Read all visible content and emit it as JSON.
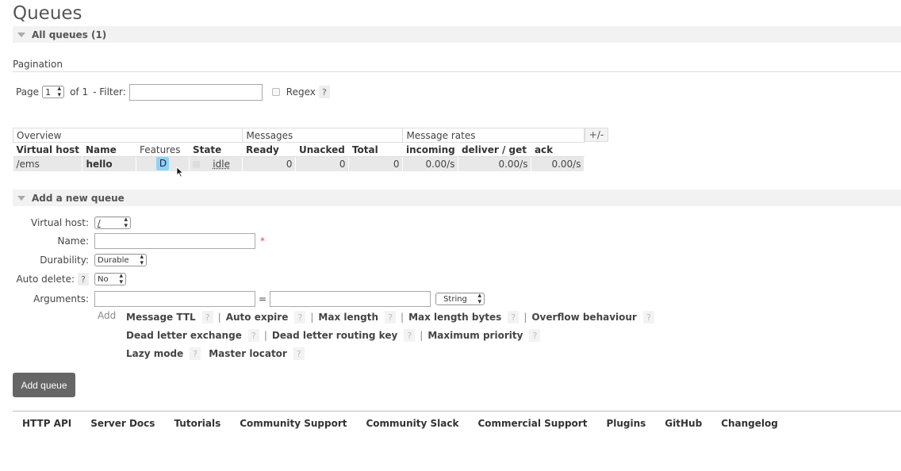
{
  "page_title": "Queues",
  "all_queues_label": "All queues (1)",
  "pagination": {
    "label": "Pagination",
    "page_prefix": "Page",
    "page_value": "1",
    "of_text": "of 1",
    "filter_label": "- Filter:",
    "filter_value": "",
    "regex_label": "Regex",
    "help": "?"
  },
  "table": {
    "groups": [
      "Overview",
      "Messages",
      "Message rates"
    ],
    "columns": [
      "Virtual host",
      "Name",
      "Features",
      "State",
      "Ready",
      "Unacked",
      "Total",
      "incoming",
      "deliver / get",
      "ack"
    ],
    "toggle": "+/-",
    "rows": [
      {
        "vhost": "/ems",
        "name": "hello",
        "feature": "D",
        "state": "idle",
        "ready": "0",
        "unacked": "0",
        "total": "0",
        "incoming": "0.00/s",
        "deliver_get": "0.00/s",
        "ack": "0.00/s"
      }
    ]
  },
  "add_queue_section": {
    "title": "Add a new queue",
    "virtual_host_label": "Virtual host:",
    "virtual_host_value": "/",
    "name_label": "Name:",
    "name_value": "",
    "required_mark": "*",
    "durability_label": "Durability:",
    "durability_value": "Durable",
    "auto_delete_label": "Auto delete:",
    "auto_delete_value": "No",
    "arguments_label": "Arguments:",
    "arg_equals": "=",
    "arg_type_value": "String",
    "add_text": "Add",
    "arg_links_row1": [
      "Message TTL",
      "Auto expire",
      "Max length",
      "Max length bytes",
      "Overflow behaviour"
    ],
    "arg_links_row2": [
      "Dead letter exchange",
      "Dead letter routing key",
      "Maximum priority"
    ],
    "arg_links_row3": [
      "Lazy mode",
      "Master locator"
    ],
    "help": "?",
    "separator": "|",
    "submit_label": "Add queue"
  },
  "footer_links": [
    "HTTP API",
    "Server Docs",
    "Tutorials",
    "Community Support",
    "Community Slack",
    "Commercial Support",
    "Plugins",
    "GitHub",
    "Changelog"
  ],
  "icons": {
    "section_toggle": "triangle-down-icon",
    "select_arrows": "updown-arrows-icon",
    "cursor": "pointer-cursor-icon"
  },
  "colors": {
    "feature_badge": "#8fd3f4",
    "button_bg": "#666666",
    "section_bg": "#f2f2f2",
    "row_bg": "#e8e8e8"
  }
}
